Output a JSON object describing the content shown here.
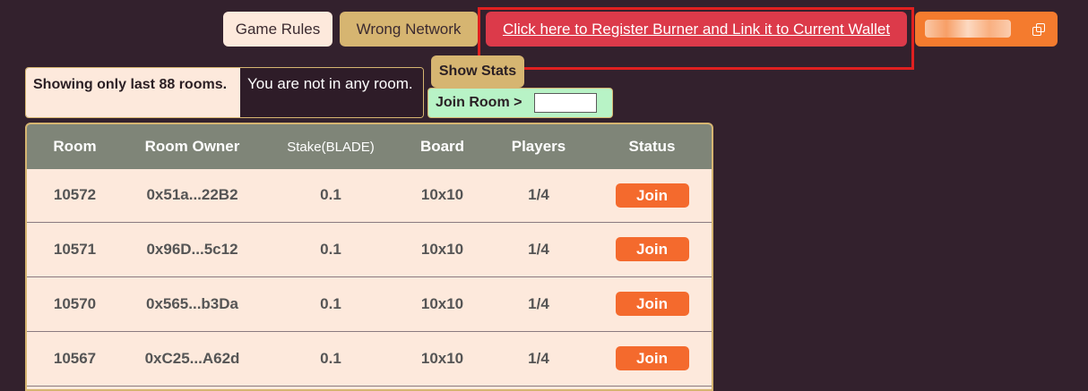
{
  "header": {
    "game_rules_label": "Game Rules",
    "network_label": "Wrong Network",
    "register_label": "Click here to Register Burner and Link it to Current Wallet",
    "wallet_label": ""
  },
  "info": {
    "showing_text": "Showing only last 88 rooms.",
    "room_status_text": "You are not in any room."
  },
  "controls": {
    "show_stats_label": "Show Stats",
    "join_room_label": "Join Room >"
  },
  "table": {
    "columns": [
      "Room",
      "Room Owner",
      "Stake(BLADE)",
      "Board",
      "Players",
      "Status"
    ],
    "rows": [
      {
        "room": "10572",
        "owner": "0x51a...22B2",
        "stake": "0.1",
        "board": "10x10",
        "players": "1/4",
        "status": "Join"
      },
      {
        "room": "10571",
        "owner": "0x96D...5c12",
        "stake": "0.1",
        "board": "10x10",
        "players": "1/4",
        "status": "Join"
      },
      {
        "room": "10570",
        "owner": "0x565...b3Da",
        "stake": "0.1",
        "board": "10x10",
        "players": "1/4",
        "status": "Join"
      },
      {
        "room": "10567",
        "owner": "0xC25...A62d",
        "stake": "0.1",
        "board": "10x10",
        "players": "1/4",
        "status": "Join"
      }
    ]
  },
  "colors": {
    "background": "#33212d",
    "register_button": "#dc3a4a",
    "highlight": "#e02020",
    "join_button": "#f46a2d",
    "table_header": "#7f8578"
  }
}
